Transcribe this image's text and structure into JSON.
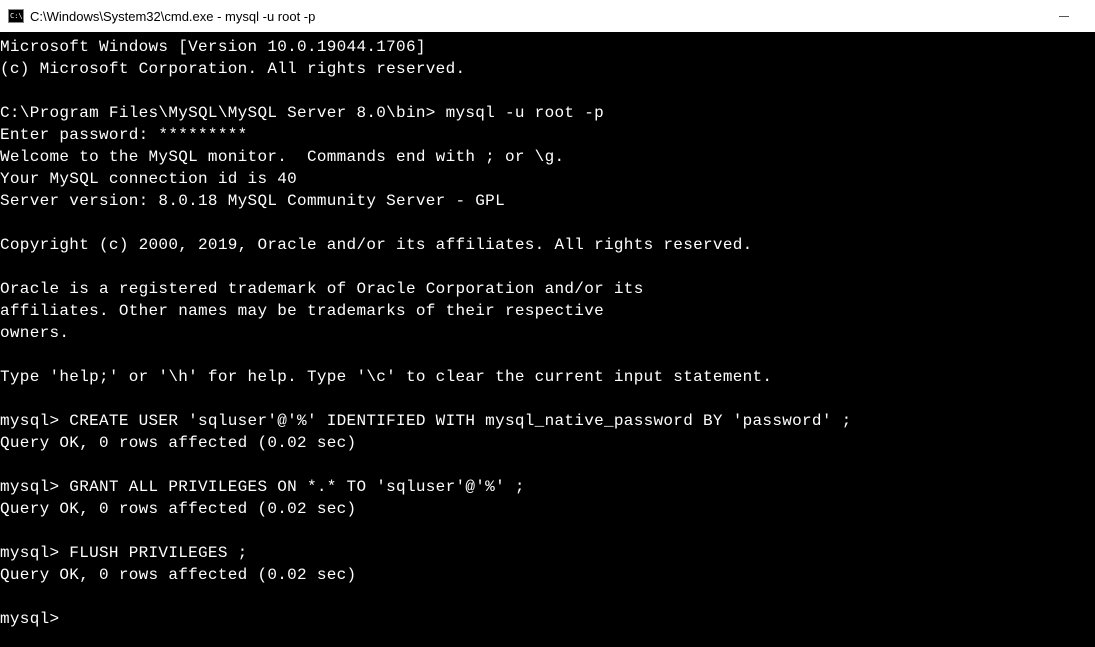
{
  "titlebar": {
    "icon_label": "C:\\.",
    "title": "C:\\Windows\\System32\\cmd.exe - mysql  -u root -p"
  },
  "terminal": {
    "lines": [
      "Microsoft Windows [Version 10.0.19044.1706]",
      "(c) Microsoft Corporation. All rights reserved.",
      "",
      "C:\\Program Files\\MySQL\\MySQL Server 8.0\\bin> mysql -u root -p",
      "Enter password: *********",
      "Welcome to the MySQL monitor.  Commands end with ; or \\g.",
      "Your MySQL connection id is 40",
      "Server version: 8.0.18 MySQL Community Server - GPL",
      "",
      "Copyright (c) 2000, 2019, Oracle and/or its affiliates. All rights reserved.",
      "",
      "Oracle is a registered trademark of Oracle Corporation and/or its",
      "affiliates. Other names may be trademarks of their respective",
      "owners.",
      "",
      "Type 'help;' or '\\h' for help. Type '\\c' to clear the current input statement.",
      "",
      "mysql> CREATE USER 'sqluser'@'%' IDENTIFIED WITH mysql_native_password BY 'password' ;",
      "Query OK, 0 rows affected (0.02 sec)",
      "",
      "mysql> GRANT ALL PRIVILEGES ON *.* TO 'sqluser'@'%' ;",
      "Query OK, 0 rows affected (0.02 sec)",
      "",
      "mysql> FLUSH PRIVILEGES ;",
      "Query OK, 0 rows affected (0.02 sec)",
      "",
      "mysql>"
    ]
  }
}
